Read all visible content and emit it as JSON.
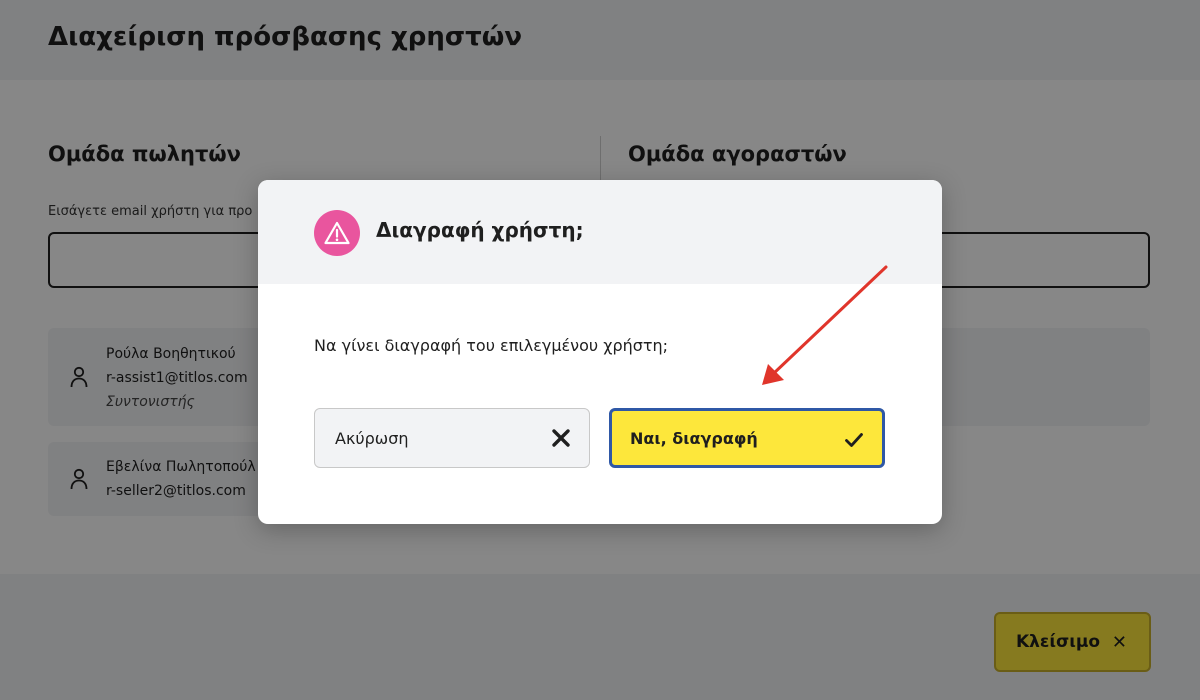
{
  "page": {
    "title": "Διαχείριση πρόσβασης χρηστών",
    "sellers": {
      "title": "Ομάδα πωλητών",
      "input_label": "Εισάγετε email χρήστη για προ",
      "users": [
        {
          "name": "Ρούλα Βοηθητικού",
          "email": "r-assist1@titlos.com",
          "role": "Συντονιστής"
        },
        {
          "name": "Εβελίνα Πωλητοπούλ",
          "email": "r-seller2@titlos.com"
        }
      ]
    },
    "buyers": {
      "title": "Ομάδα αγοραστών"
    },
    "footer": {
      "close_label": "Κλείσιμο",
      "close_icon": "close-icon"
    }
  },
  "modal": {
    "title": "Διαγραφή χρήστη;",
    "icon": "warning-icon",
    "icon_color": "#e9559e",
    "message": "Να γίνει διαγραφή του επιλεγμένου χρήστη;",
    "cancel_label": "Ακύρωση",
    "confirm_label": "Ναι, διαγραφή"
  },
  "colors": {
    "accent_yellow": "#fde73b",
    "focus_blue": "#2f58a6",
    "annotation_red": "#e0352b"
  }
}
